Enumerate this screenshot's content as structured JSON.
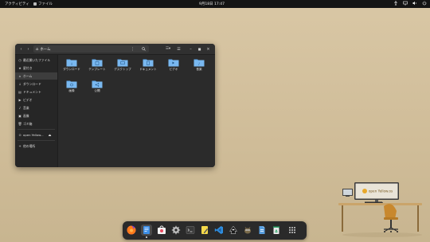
{
  "topbar": {
    "activities": "アクティビティ",
    "app_name": "ファイル",
    "clock": "9月18日 17:47",
    "tray": [
      "accessibility-icon",
      "network-icon",
      "volume-icon",
      "power-icon"
    ]
  },
  "window": {
    "path": "ホーム",
    "sidebar": [
      {
        "icon": "clock-icon",
        "label": "最近開いたファイル"
      },
      {
        "icon": "star-icon",
        "label": "星付き"
      },
      {
        "icon": "home-icon",
        "label": "ホーム",
        "active": true
      },
      {
        "icon": "download-icon",
        "label": "ダウンロード"
      },
      {
        "icon": "document-icon",
        "label": "ドキュメント"
      },
      {
        "icon": "video-icon",
        "label": "ビデオ"
      },
      {
        "icon": "music-icon",
        "label": "音楽"
      },
      {
        "icon": "picture-icon",
        "label": "画像"
      },
      {
        "icon": "trash-icon",
        "label": "ゴミ箱"
      },
      {
        "icon": "drive-icon",
        "label": "open Yellow..."
      },
      {
        "icon": "plus-icon",
        "label": "他の場所"
      }
    ],
    "folders": [
      {
        "label": "ダウンロード",
        "glyph": "↓"
      },
      {
        "label": "テンプレート",
        "glyph": "▭"
      },
      {
        "label": "デスクトップ",
        "glyph": "▢"
      },
      {
        "label": "ドキュメント",
        "glyph": "▤"
      },
      {
        "label": "ビデオ",
        "glyph": "▶"
      },
      {
        "label": "音楽",
        "glyph": "♪"
      },
      {
        "label": "画像",
        "glyph": "◉"
      },
      {
        "label": "公開",
        "glyph": "⤢"
      }
    ]
  },
  "dock": [
    {
      "name": "firefox",
      "active": false,
      "color": "#ff7a1a"
    },
    {
      "name": "files",
      "active": true,
      "color": "#3d8fe6"
    },
    {
      "name": "software-center",
      "active": false,
      "color": "#e84a5f"
    },
    {
      "name": "settings",
      "active": false,
      "color": "#bdbdbd"
    },
    {
      "name": "terminal",
      "active": false,
      "color": "#3a3a3a"
    },
    {
      "name": "text-editor",
      "active": false,
      "color": "#f5d94a"
    },
    {
      "name": "vscode",
      "active": false,
      "color": "#2f8ee0"
    },
    {
      "name": "inkscape",
      "active": false,
      "color": "#1a1a1a"
    },
    {
      "name": "gimp",
      "active": false,
      "color": "#7a6a4a"
    },
    {
      "name": "document-viewer",
      "active": false,
      "color": "#5aa0e0"
    },
    {
      "name": "recycle-bin",
      "active": false,
      "color": "#2fa86a"
    },
    {
      "name": "app-grid",
      "active": false,
      "color": "#d0d0d0"
    }
  ],
  "desk": {
    "monitor_text": "open Yellow.os"
  }
}
